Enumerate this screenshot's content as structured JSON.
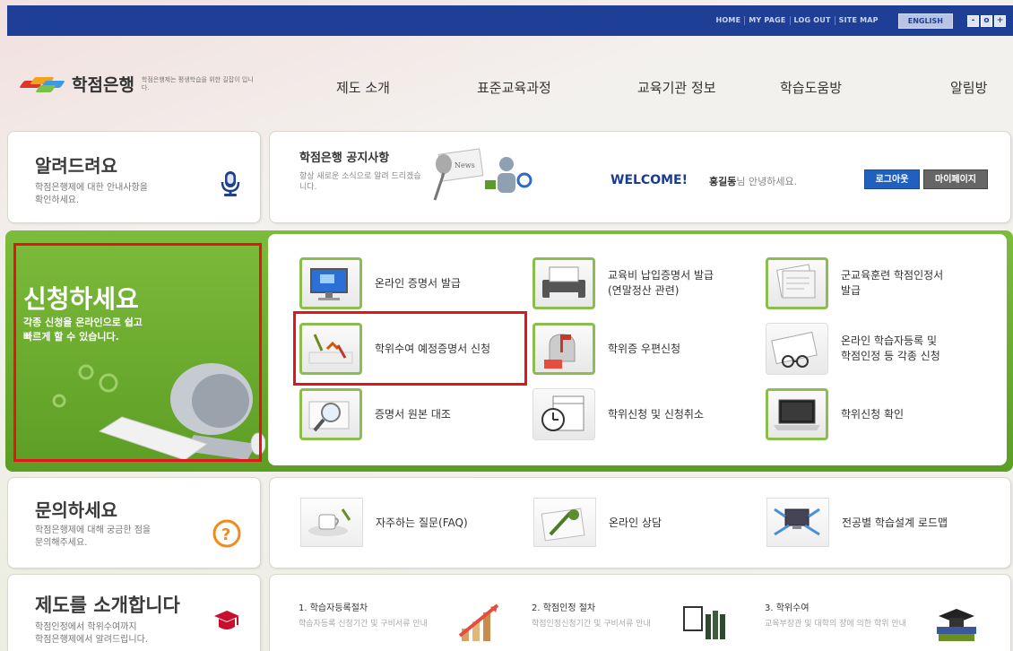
{
  "topbar": {
    "links": [
      "HOME",
      "MY PAGE",
      "LOG OUT",
      "SITE MAP"
    ],
    "english": "ENGLISH",
    "window_buttons": [
      "-",
      "o",
      "+"
    ]
  },
  "logo": {
    "title": "학점은행",
    "subtitle": "학점은행제는 평생학습을 위한 길잡이 입니다."
  },
  "nav": [
    "제도 소개",
    "표준교육과정",
    "교육기관 정보",
    "학습도움방",
    "알림방"
  ],
  "notice_card": {
    "title": "알려드려요",
    "desc_line1": "학점은행제에 대한 안내사항을",
    "desc_line2": "확인하세요."
  },
  "announcement": {
    "title": "학점은행 공지사항",
    "desc": "항상 새로운 소식으로 알려 드리겠습니다.",
    "welcome": "WELCOME!",
    "user_name": "홍길동",
    "greeting_suffix": "님 안녕하세요.",
    "logout_button": "로그아웃",
    "mypage_button": "마이페이지"
  },
  "apply": {
    "title": "신청하세요",
    "desc_line1": "각종 신청을 온라인으로 쉽고",
    "desc_line2": "빠르게 할 수 있습니다.",
    "services": [
      {
        "label1": "온라인 증명서 발급",
        "label2": ""
      },
      {
        "label1": "교육비 납입증명서 발급",
        "label2": "(연말정산 관련)"
      },
      {
        "label1": "군교육훈련 학점인정서",
        "label2": "발급"
      },
      {
        "label1": "학위수여 예정증명서 신청",
        "label2": ""
      },
      {
        "label1": "학위증 우편신청",
        "label2": ""
      },
      {
        "label1": "온라인 학습자등록 및",
        "label2": "학점인정 등 각종 신청"
      },
      {
        "label1": "증명서 원본 대조",
        "label2": ""
      },
      {
        "label1": "학위신청 및 신청취소",
        "label2": ""
      },
      {
        "label1": "학위신청 확인",
        "label2": ""
      }
    ]
  },
  "contact": {
    "title": "문의하세요",
    "desc_line1": "학점은행제에 대해 궁금한 점을",
    "desc_line2": "문의해주세요.",
    "items": [
      "자주하는 질문(FAQ)",
      "온라인 상담",
      "전공별 학습설계 로드맵"
    ]
  },
  "intro": {
    "title": "제도를 소개합니다",
    "desc_line1": "학점인정에서 학위수여까지",
    "desc_line2": "학점은행제에서 알려드립니다.",
    "steps": [
      {
        "title": "1. 학습자등록절차",
        "desc": "학습자등록 신청기간 및 구비서류 안내"
      },
      {
        "title": "2. 학점인정 절차",
        "desc": "학점인정신청기간 및 구비서류 안내"
      },
      {
        "title": "3. 학위수여",
        "desc": "교육부장관 및 대학의 장에 의한 학위 안내"
      }
    ]
  },
  "colors": {
    "topbar": "#1e3f95",
    "green": "#6aaa2f",
    "highlight": "#e0161a",
    "logout": "#2160bf"
  }
}
